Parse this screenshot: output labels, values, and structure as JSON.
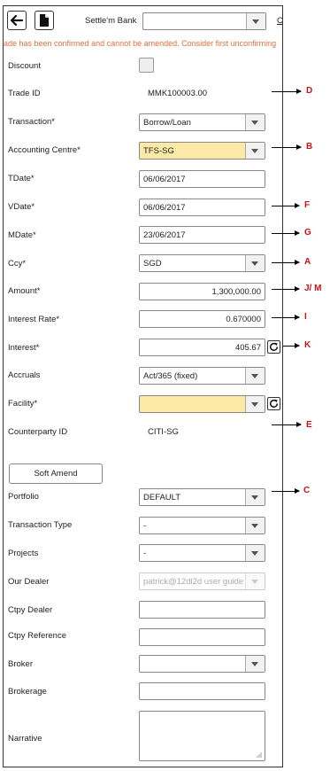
{
  "toolbar": {
    "back_icon": "arrow-left-icon",
    "doc_icon": "document-icon",
    "settle_bank_label": "Settle'm Bank",
    "settle_bank_value": "",
    "truncated_link": "C"
  },
  "warning": "ade has been confirmed and cannot be amended. Consider first unconfirming",
  "form": {
    "discount": {
      "label": "Discount",
      "checked": false
    },
    "trade_id": {
      "label": "Trade ID",
      "value": "MMK100003.00"
    },
    "transaction": {
      "label": "Transaction*",
      "value": "Borrow/Loan"
    },
    "accounting_centre": {
      "label": "Accounting Centre*",
      "value": "TFS-SG"
    },
    "tdate": {
      "label": "TDate*",
      "value": "06/06/2017"
    },
    "vdate": {
      "label": "VDate*",
      "value": "06/06/2017"
    },
    "mdate": {
      "label": "MDate*",
      "value": "23/06/2017"
    },
    "ccy": {
      "label": "Ccy*",
      "value": "SGD"
    },
    "amount": {
      "label": "Amount*",
      "value": "1,300,000.00"
    },
    "interest_rate": {
      "label": "Interest Rate*",
      "value": "0.670000"
    },
    "interest": {
      "label": "Interest*",
      "value": "405.67"
    },
    "accruals": {
      "label": "Accruals",
      "value": "Act/365 (fixed)"
    },
    "facility": {
      "label": "Facility*",
      "value": ""
    },
    "counterparty_id": {
      "label": "Counterparty ID",
      "value": "CITI-SG"
    },
    "soft_amend": "Soft Amend",
    "portfolio": {
      "label": "Portfolio",
      "value": "DEFAULT"
    },
    "transaction_type": {
      "label": "Transaction Type",
      "value": "-"
    },
    "projects": {
      "label": "Projects",
      "value": "-"
    },
    "our_dealer": {
      "label": "Our Dealer",
      "value": "patrick@12dl2d user guide"
    },
    "ctpy_dealer": {
      "label": "Ctpy Dealer",
      "value": ""
    },
    "ctpy_reference": {
      "label": "Ctpy Reference",
      "value": ""
    },
    "broker": {
      "label": "Broker",
      "value": ""
    },
    "brokerage": {
      "label": "Brokerage",
      "value": ""
    },
    "narrative": {
      "label": "Narrative",
      "value": ""
    }
  },
  "callouts": {
    "trade_id": "D",
    "accounting_centre": "B",
    "vdate": "F",
    "mdate": "G",
    "ccy": "A",
    "amount": "J/ M",
    "interest_rate": "I",
    "interest": "K",
    "counterparty_id": "E",
    "portfolio": "C"
  },
  "colors": {
    "warning": "#e0703a",
    "callout": "#cc1111",
    "highlight_field": "#fde9a6"
  }
}
